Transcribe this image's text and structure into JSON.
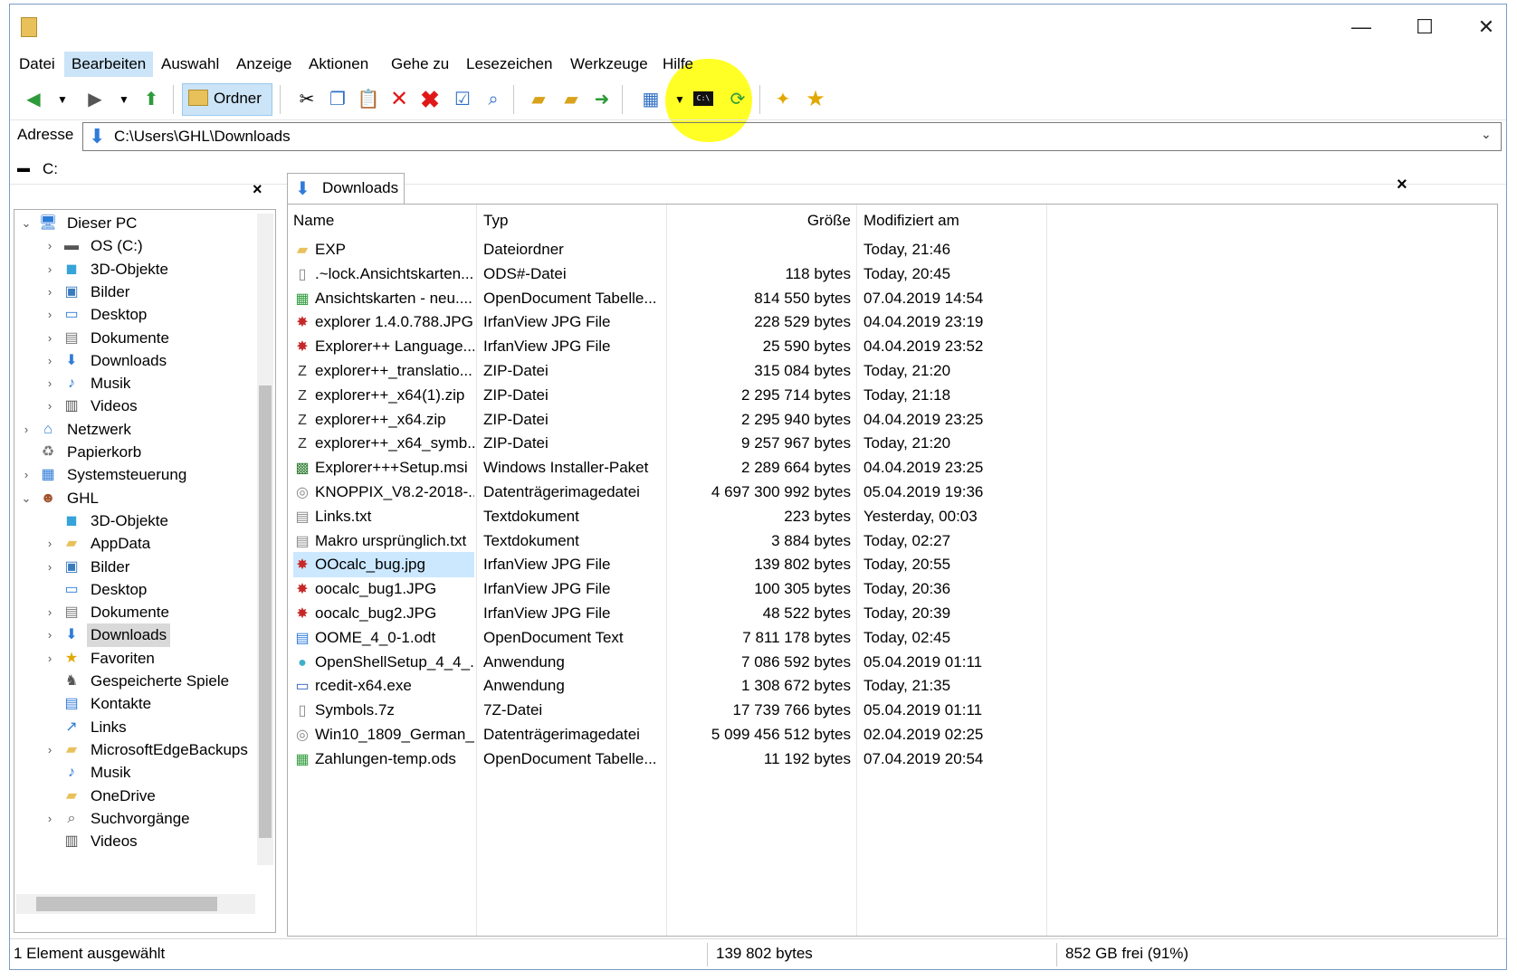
{
  "window": {
    "icon": "folder-icon",
    "controls": {
      "minimize": "—",
      "maximize": "☐",
      "close": "✕"
    }
  },
  "menu": [
    "Datei",
    "Bearbeiten",
    "Auswahl",
    "Anzeige",
    "Aktionen",
    "Gehe zu",
    "Lesezeichen",
    "Werkzeuge",
    "Hilfe"
  ],
  "toolbar": {
    "folders_label": "Ordner",
    "icons": [
      "back-icon",
      "forward-icon",
      "up-icon",
      "cut-icon",
      "copy-icon",
      "paste-icon",
      "delete-icon",
      "delete-permanent-icon",
      "properties-icon",
      "search-icon",
      "new-folder-icon",
      "copy-to-icon",
      "move-to-icon",
      "view-icon",
      "command-prompt-icon",
      "refresh-icon",
      "bookmark-tab-icon",
      "bookmarks-icon"
    ]
  },
  "address": {
    "label": "Adresse",
    "path": "C:\\Users\\GHL\\Downloads"
  },
  "drivebar": {
    "drive": "C:"
  },
  "tree": [
    {
      "label": "Dieser PC",
      "icon": "computer-icon",
      "level": 0,
      "expander": "⌄"
    },
    {
      "label": "OS (C:)",
      "icon": "drive-icon",
      "level": 1,
      "expander": "›"
    },
    {
      "label": "3D-Objekte",
      "icon": "cube-icon",
      "level": 1,
      "expander": "›"
    },
    {
      "label": "Bilder",
      "icon": "pictures-icon",
      "level": 1,
      "expander": "›"
    },
    {
      "label": "Desktop",
      "icon": "desktop-icon",
      "level": 1,
      "expander": "›"
    },
    {
      "label": "Dokumente",
      "icon": "documents-icon",
      "level": 1,
      "expander": "›"
    },
    {
      "label": "Downloads",
      "icon": "download-icon",
      "level": 1,
      "expander": "›"
    },
    {
      "label": "Musik",
      "icon": "music-icon",
      "level": 1,
      "expander": "›"
    },
    {
      "label": "Videos",
      "icon": "video-icon",
      "level": 1,
      "expander": "›"
    },
    {
      "label": "Netzwerk",
      "icon": "network-icon",
      "level": 0,
      "expander": "›"
    },
    {
      "label": "Papierkorb",
      "icon": "recycle-bin-icon",
      "level": 0,
      "expander": ""
    },
    {
      "label": "Systemsteuerung",
      "icon": "control-panel-icon",
      "level": 0,
      "expander": "›"
    },
    {
      "label": "GHL",
      "icon": "user-icon",
      "level": 0,
      "expander": "⌄"
    },
    {
      "label": "3D-Objekte",
      "icon": "cube-icon",
      "level": 1,
      "expander": ""
    },
    {
      "label": "AppData",
      "icon": "folder-icon",
      "level": 1,
      "expander": "›"
    },
    {
      "label": "Bilder",
      "icon": "pictures-icon",
      "level": 1,
      "expander": "›"
    },
    {
      "label": "Desktop",
      "icon": "desktop-icon",
      "level": 1,
      "expander": ""
    },
    {
      "label": "Dokumente",
      "icon": "documents-icon",
      "level": 1,
      "expander": "›"
    },
    {
      "label": "Downloads",
      "icon": "download-icon",
      "level": 1,
      "expander": "›",
      "selected": true
    },
    {
      "label": "Favoriten",
      "icon": "star-icon",
      "level": 1,
      "expander": "›"
    },
    {
      "label": "Gespeicherte Spiele",
      "icon": "games-icon",
      "level": 1,
      "expander": ""
    },
    {
      "label": "Kontakte",
      "icon": "contacts-icon",
      "level": 1,
      "expander": ""
    },
    {
      "label": "Links",
      "icon": "links-icon",
      "level": 1,
      "expander": ""
    },
    {
      "label": "MicrosoftEdgeBackups",
      "icon": "folder-icon",
      "level": 1,
      "expander": "›"
    },
    {
      "label": "Musik",
      "icon": "music-icon",
      "level": 1,
      "expander": ""
    },
    {
      "label": "OneDrive",
      "icon": "folder-icon",
      "level": 1,
      "expander": ""
    },
    {
      "label": "Suchvorgänge",
      "icon": "search-icon",
      "level": 1,
      "expander": "›"
    },
    {
      "label": "Videos",
      "icon": "video-icon",
      "level": 1,
      "expander": ""
    }
  ],
  "tab": {
    "label": "Downloads"
  },
  "columns": {
    "name": "Name",
    "type": "Typ",
    "size": "Größe",
    "modified": "Modifiziert am"
  },
  "files": [
    {
      "name": "EXP",
      "type": "Dateiordner",
      "size": "",
      "modified": "Today, 21:46",
      "icon": "folder-icon"
    },
    {
      "name": ".~lock.Ansichtskarten...",
      "type": "ODS#-Datei",
      "size": "118 bytes",
      "modified": "Today, 20:45",
      "icon": "file-icon"
    },
    {
      "name": "Ansichtskarten - neu....",
      "type": "OpenDocument Tabelle...",
      "size": "814 550 bytes",
      "modified": "07.04.2019 14:54",
      "icon": "spreadsheet-icon"
    },
    {
      "name": "explorer 1.4.0.788.JPG",
      "type": "IrfanView JPG File",
      "size": "228 529 bytes",
      "modified": "04.04.2019 23:19",
      "icon": "image-icon"
    },
    {
      "name": "Explorer++ Language...",
      "type": "IrfanView JPG File",
      "size": "25 590 bytes",
      "modified": "04.04.2019 23:52",
      "icon": "image-icon"
    },
    {
      "name": "explorer++_translatio...",
      "type": "ZIP-Datei",
      "size": "315 084 bytes",
      "modified": "Today, 21:20",
      "icon": "zip-icon"
    },
    {
      "name": "explorer++_x64(1).zip",
      "type": "ZIP-Datei",
      "size": "2 295 714 bytes",
      "modified": "Today, 21:18",
      "icon": "zip-icon"
    },
    {
      "name": "explorer++_x64.zip",
      "type": "ZIP-Datei",
      "size": "2 295 940 bytes",
      "modified": "04.04.2019 23:25",
      "icon": "zip-icon"
    },
    {
      "name": "explorer++_x64_symb...",
      "type": "ZIP-Datei",
      "size": "9 257 967 bytes",
      "modified": "Today, 21:20",
      "icon": "zip-icon"
    },
    {
      "name": "Explorer+++Setup.msi",
      "type": "Windows Installer-Paket",
      "size": "2 289 664 bytes",
      "modified": "04.04.2019 23:25",
      "icon": "installer-icon"
    },
    {
      "name": "KNOPPIX_V8.2-2018-...",
      "type": "Datenträgerimagedatei",
      "size": "4 697 300 992 bytes",
      "modified": "05.04.2019 19:36",
      "icon": "disc-image-icon"
    },
    {
      "name": "Links.txt",
      "type": "Textdokument",
      "size": "223 bytes",
      "modified": "Yesterday, 00:03",
      "icon": "text-icon"
    },
    {
      "name": "Makro ursprünglich.txt",
      "type": "Textdokument",
      "size": "3 884 bytes",
      "modified": "Today, 02:27",
      "icon": "text-icon"
    },
    {
      "name": "OOcalc_bug.jpg",
      "type": "IrfanView JPG File",
      "size": "139 802 bytes",
      "modified": "Today, 20:55",
      "icon": "image-icon",
      "selected": true
    },
    {
      "name": "oocalc_bug1.JPG",
      "type": "IrfanView JPG File",
      "size": "100 305 bytes",
      "modified": "Today, 20:36",
      "icon": "image-icon"
    },
    {
      "name": "oocalc_bug2.JPG",
      "type": "IrfanView JPG File",
      "size": "48 522 bytes",
      "modified": "Today, 20:39",
      "icon": "image-icon"
    },
    {
      "name": "OOME_4_0-1.odt",
      "type": "OpenDocument Text",
      "size": "7 811 178 bytes",
      "modified": "Today, 02:45",
      "icon": "document-icon"
    },
    {
      "name": "OpenShellSetup_4_4_...",
      "type": "Anwendung",
      "size": "7 086 592 bytes",
      "modified": "05.04.2019 01:11",
      "icon": "shell-icon"
    },
    {
      "name": "rcedit-x64.exe",
      "type": "Anwendung",
      "size": "1 308 672 bytes",
      "modified": "Today, 21:35",
      "icon": "app-icon"
    },
    {
      "name": "Symbols.7z",
      "type": "7Z-Datei",
      "size": "17 739 766 bytes",
      "modified": "05.04.2019 01:11",
      "icon": "file-icon"
    },
    {
      "name": "Win10_1809_German_...",
      "type": "Datenträgerimagedatei",
      "size": "5 099 456 512 bytes",
      "modified": "02.04.2019 02:25",
      "icon": "disc-image-icon"
    },
    {
      "name": "Zahlungen-temp.ods",
      "type": "OpenDocument Tabelle...",
      "size": "11 192 bytes",
      "modified": "07.04.2019 20:54",
      "icon": "spreadsheet-icon"
    }
  ],
  "status": {
    "selection": "1 Element ausgewählt",
    "size": "139 802 bytes",
    "free": "852 GB frei (91%)"
  }
}
